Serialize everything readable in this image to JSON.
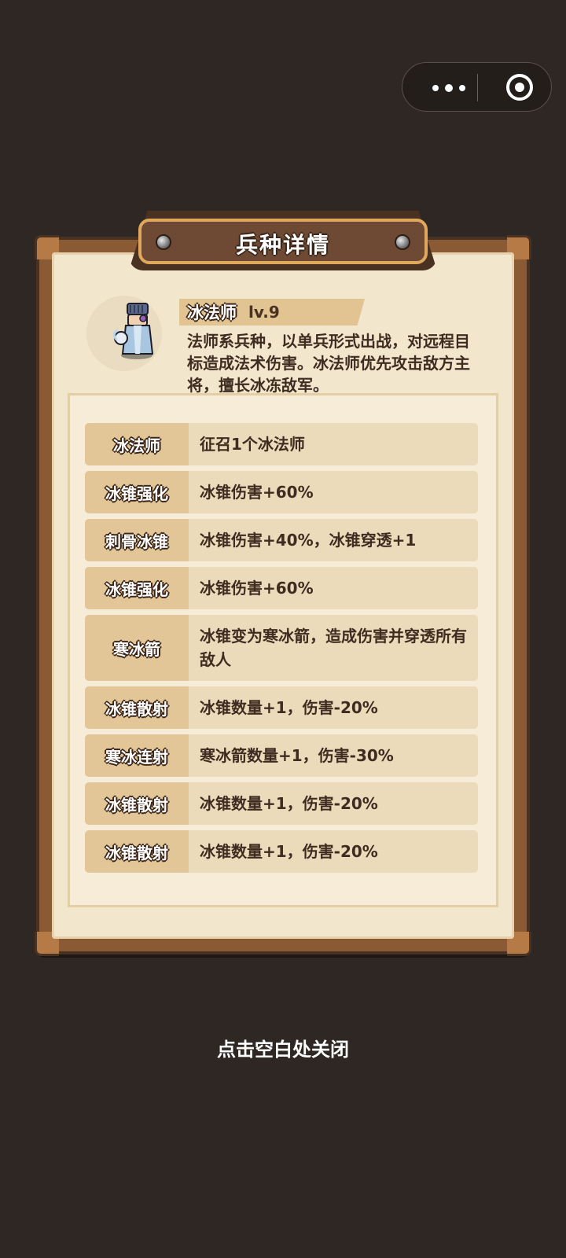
{
  "capsule": {
    "more_icon": "more-dots-icon",
    "close_icon": "target-circle-icon"
  },
  "dialog": {
    "title": "兵种详情"
  },
  "unit": {
    "name": "冰法师",
    "level": "lv.9",
    "portrait": "ice-mage-portrait",
    "description": "法师系兵种，以单兵形式出战，对远程目标造成法术伤害。冰法师优先攻击敌方主将，擅长冰冻敌军。"
  },
  "skills": [
    {
      "name": "冰法师",
      "effect": "征召1个冰法师"
    },
    {
      "name": "冰锥强化",
      "effect": "冰锥伤害+60%"
    },
    {
      "name": "刺骨冰锥",
      "effect": "冰锥伤害+40%，冰锥穿透+1"
    },
    {
      "name": "冰锥强化",
      "effect": "冰锥伤害+60%"
    },
    {
      "name": "寒冰箭",
      "effect": "冰锥变为寒冰箭，造成伤害并穿透所有敌人"
    },
    {
      "name": "冰锥散射",
      "effect": "冰锥数量+1，伤害-20%"
    },
    {
      "name": "寒冰连射",
      "effect": "寒冰箭数量+1，伤害-30%"
    },
    {
      "name": "冰锥散射",
      "effect": "冰锥数量+1，伤害-20%"
    },
    {
      "name": "冰锥散射",
      "effect": "冰锥数量+1，伤害-20%"
    }
  ],
  "footer": {
    "close_hint": "点击空白处关闭"
  },
  "colors": {
    "background": "#2e2723",
    "parchment": "#f2e6cd",
    "frame": "#8a5a34",
    "title_border": "#e0a85a"
  }
}
